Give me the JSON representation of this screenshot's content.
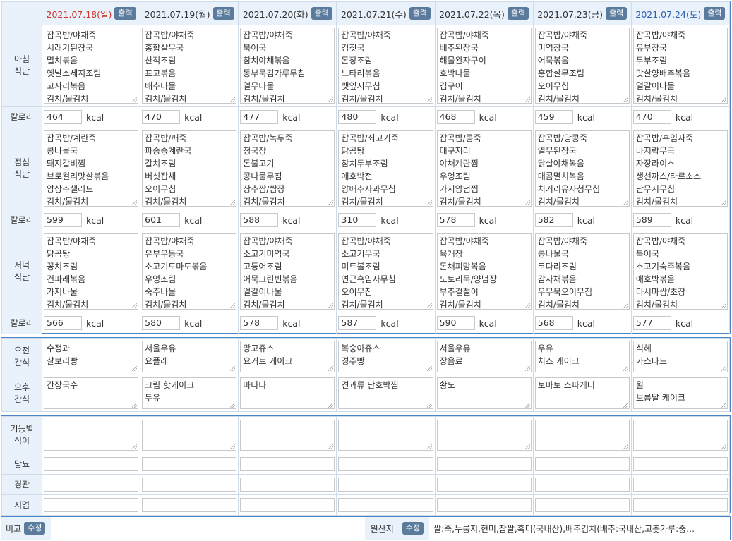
{
  "print_label": "출력",
  "edit_label": "수정",
  "kcal_unit": "kcal",
  "days": [
    {
      "date": "2021.07.18(일)",
      "type": "sun"
    },
    {
      "date": "2021.07.19(월)",
      "type": "weekday"
    },
    {
      "date": "2021.07.20(화)",
      "type": "weekday"
    },
    {
      "date": "2021.07.21(수)",
      "type": "weekday"
    },
    {
      "date": "2021.07.22(목)",
      "type": "weekday"
    },
    {
      "date": "2021.07.23(금)",
      "type": "weekday"
    },
    {
      "date": "2021.07.24(토)",
      "type": "sat"
    }
  ],
  "labels": {
    "breakfast": [
      "아침",
      "식단"
    ],
    "lunch": [
      "점심",
      "식단"
    ],
    "dinner": [
      "저녁",
      "식단"
    ],
    "calorie": "칼로리",
    "am_snack": [
      "오전",
      "간식"
    ],
    "pm_snack": [
      "오후",
      "간식"
    ],
    "functional": [
      "기능별",
      "식이"
    ],
    "diabetes": "당뇨",
    "tube": "경관",
    "low_salt": "저염",
    "remarks": "비고",
    "origin": "원산지"
  },
  "breakfast": [
    [
      "잡곡밥/야채죽",
      "시래기된장국",
      "멸치볶음",
      "옛날소세지조림",
      "고사리볶음",
      "김치/물김치"
    ],
    [
      "잡곡밥/야채죽",
      "홍합살무국",
      "산적조림",
      "표고볶음",
      "배추나물",
      "김치/물김치"
    ],
    [
      "잡곡밥/야채죽",
      "북어국",
      "참치야채볶음",
      "동부묵김가루무침",
      "열무나물",
      "김치/물김치"
    ],
    [
      "잡곡밥/야채죽",
      "김칫국",
      "돈장조림",
      "느타리볶음",
      "깻잎지무침",
      "김치/물김치"
    ],
    [
      "잡곡밥/야채죽",
      "배추된장국",
      "해물완자구이",
      "호박나물",
      "김구이",
      "김치/물김치"
    ],
    [
      "잡곡밥/야채죽",
      "미역장국",
      "어묵볶음",
      "홍합살무조림",
      "오이무침",
      "김치/물김치"
    ],
    [
      "잡곡밥/야채죽",
      "유부장국",
      "두부조림",
      "맛살양배추볶음",
      "얼갈이나물",
      "김치/물김치"
    ]
  ],
  "breakfast_kcal": [
    "464",
    "470",
    "477",
    "480",
    "468",
    "459",
    "470"
  ],
  "lunch": [
    [
      "잡곡밥/계란죽",
      "콩나물국",
      "돼지갈비찜",
      "브로컬리맛살볶음",
      "양상추샐러드",
      "김치/물김치"
    ],
    [
      "잡곡밥/깨죽",
      "파송송계란국",
      "갈치조림",
      "버섯잡채",
      "오이무침",
      "김치/물김치"
    ],
    [
      "잡곡밥/녹두죽",
      "청국장",
      "돈불고기",
      "콩나물무침",
      "상추쌈/쌈장",
      "김치/물김치"
    ],
    [
      "잡곡밥/쇠고기죽",
      "닭곰탕",
      "참치두부조림",
      "애호박전",
      "양배추사과무침",
      "김치/물김치"
    ],
    [
      "잡곡밥/콩죽",
      "대구지리",
      "야채계란찜",
      "우엉조림",
      "가지양념찜",
      "김치/물김치"
    ],
    [
      "잡곡밥/당콩죽",
      "열무된장국",
      "닭살야채볶음",
      "매콤멸치볶음",
      "치커리유자청무침",
      "김치/물김치"
    ],
    [
      "잡곡밥/흑임자죽",
      "바지락무국",
      "자장라이스",
      "생선까스/타르소스",
      "단무지무침",
      "김치/물김치"
    ]
  ],
  "lunch_kcal": [
    "599",
    "601",
    "588",
    "310",
    "578",
    "582",
    "589"
  ],
  "dinner": [
    [
      "잡곡밥/야채죽",
      "닭곰탕",
      "꽁치조림",
      "건파래볶음",
      "가지나물",
      "김치/물김치"
    ],
    [
      "잡곡밥/야채죽",
      "유부우동국",
      "소고기토마토볶음",
      "우엉조림",
      "숙주나물",
      "김치/물김치"
    ],
    [
      "잡곡밥/야채죽",
      "소고기미역국",
      "고등어조림",
      "어묵그린빈볶음",
      "얼갈이나물",
      "김치/물김치"
    ],
    [
      "잡곡밥/야채죽",
      "소고기무국",
      "미트볼조림",
      "연근흑임자무침",
      "오이무침",
      "김치/물김치"
    ],
    [
      "잡곡밥/야채죽",
      "육개장",
      "돈채피망볶음",
      "도토리묵/양념장",
      "부추겉절이",
      "김치/물김치"
    ],
    [
      "잡곡밥/야채죽",
      "콩나물국",
      "코다리조림",
      "감자채볶음",
      "우무묵오이무침",
      "김치/물김치"
    ],
    [
      "잡곡밥/야채죽",
      "북어국",
      "소고기숙주볶음",
      "애호박볶음",
      "다시마쌈/초장",
      "김치/물김치"
    ]
  ],
  "dinner_kcal": [
    "566",
    "580",
    "578",
    "587",
    "590",
    "568",
    "577"
  ],
  "am_snack": [
    [
      "수정과",
      "찰보리빵"
    ],
    [
      "서울우유",
      "요플레"
    ],
    [
      "망고쥬스",
      "요거트 케이크"
    ],
    [
      "복숭아쥬스",
      "경주빵"
    ],
    [
      "서울우유",
      "장음료"
    ],
    [
      "우유",
      "치즈 케이크"
    ],
    [
      "식혜",
      "카스타드"
    ]
  ],
  "pm_snack": [
    [
      "간장국수"
    ],
    [
      "크림 핫케이크",
      "두유"
    ],
    [
      "바나나"
    ],
    [
      "견과류 단호박찜"
    ],
    [
      "황도"
    ],
    [
      "토마토 스파게티"
    ],
    [
      "윌",
      "보름달 케이크"
    ]
  ],
  "origin_text": "쌀:죽,누룽지,현미,찹쌀,흑미(국내산),배추김치(배추:국내산,고춧가루:중…"
}
